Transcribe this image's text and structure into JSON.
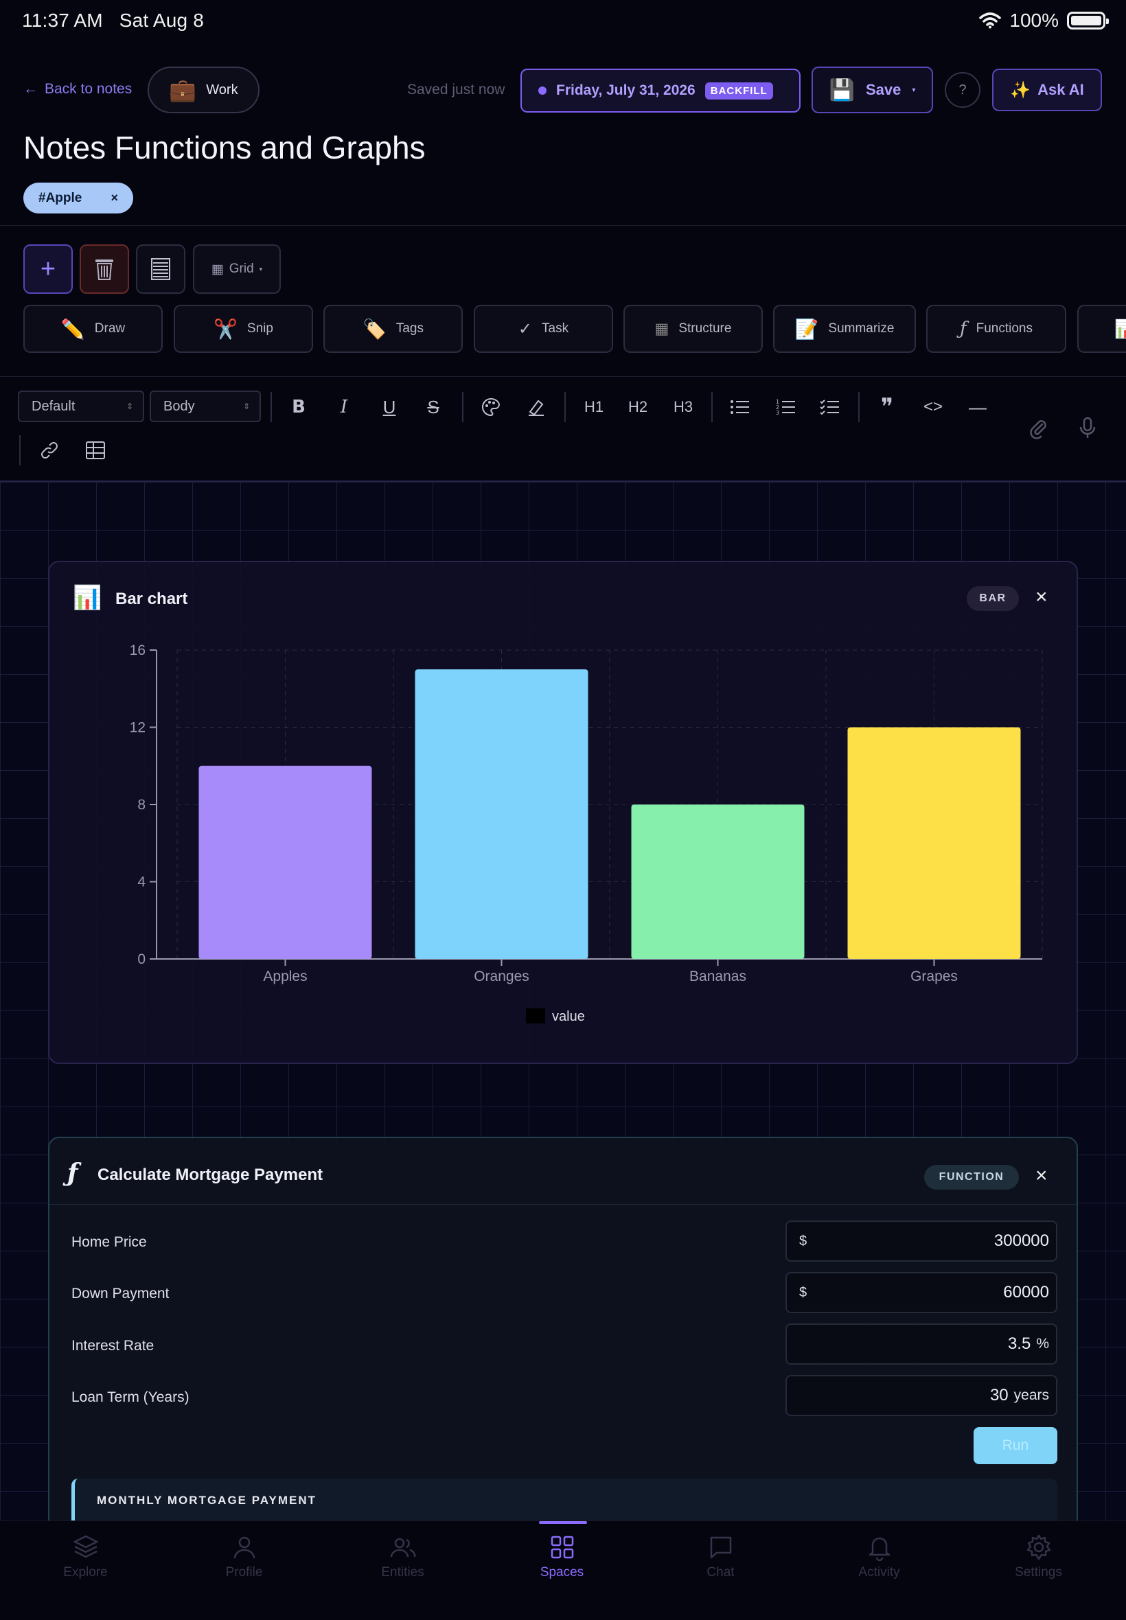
{
  "status_bar": {
    "time": "11:37 AM",
    "date": "Sat Aug 8",
    "battery": "100%"
  },
  "header": {
    "back_label": "Back to notes",
    "workspace_label": "Work",
    "saved_status": "Saved just now",
    "date_label": "Friday, July 31, 2026",
    "backfill_badge": "BACKFILL",
    "save_label": "Save",
    "help_label": "?",
    "ask_ai_label": "Ask AI"
  },
  "note": {
    "title": "Notes Functions and Graphs",
    "tag": "#Apple"
  },
  "toolbar": {
    "grid_label": "Grid",
    "actions": [
      {
        "label": "Draw",
        "icon": "pencil-icon"
      },
      {
        "label": "Snip",
        "icon": "scissors-icon"
      },
      {
        "label": "Tags",
        "icon": "tag-icon"
      },
      {
        "label": "Task",
        "icon": "check-icon"
      },
      {
        "label": "Structure",
        "icon": "structure-icon"
      },
      {
        "label": "Summarize",
        "icon": "memo-icon"
      },
      {
        "label": "Functions",
        "icon": "function-icon"
      }
    ]
  },
  "format_bar": {
    "font_select": "Default",
    "style_select": "Body",
    "headings": [
      "H1",
      "H2",
      "H3"
    ]
  },
  "chart_card": {
    "title": "Bar chart",
    "badge": "BAR",
    "close": "×"
  },
  "chart_data": {
    "type": "bar",
    "categories": [
      "Apples",
      "Oranges",
      "Bananas",
      "Grapes"
    ],
    "values": [
      10,
      15,
      8,
      12
    ],
    "colors": [
      "#a78bfa",
      "#7dd3fc",
      "#86efac",
      "#fde047"
    ],
    "series": [
      {
        "name": "value",
        "values": [
          10,
          15,
          8,
          12
        ]
      }
    ],
    "yticks": [
      0,
      4,
      8,
      12,
      16
    ],
    "ylim": [
      0,
      16
    ],
    "grid": true,
    "legend": "bottom-center"
  },
  "function_card": {
    "title": "Calculate Mortgage Payment",
    "badge": "FUNCTION",
    "close": "×",
    "fields": [
      {
        "label": "Home Price",
        "prefix": "$",
        "value": "300000",
        "suffix": ""
      },
      {
        "label": "Down Payment",
        "prefix": "$",
        "value": "60000",
        "suffix": ""
      },
      {
        "label": "Interest Rate",
        "prefix": "",
        "value": "3.5",
        "suffix": "%"
      },
      {
        "label": "Loan Term (Years)",
        "prefix": "",
        "value": "30",
        "suffix": "years"
      }
    ],
    "run_label": "Run",
    "result_label": "MONTHLY MORTGAGE PAYMENT"
  },
  "tabbar": {
    "tabs": [
      {
        "label": "Explore",
        "icon": "layers-icon"
      },
      {
        "label": "Profile",
        "icon": "person-icon"
      },
      {
        "label": "Entities",
        "icon": "people-icon"
      },
      {
        "label": "Spaces",
        "icon": "grid-icon",
        "active": true
      },
      {
        "label": "Chat",
        "icon": "chat-icon"
      },
      {
        "label": "Activity",
        "icon": "bell-icon"
      },
      {
        "label": "Settings",
        "icon": "gear-icon"
      }
    ]
  }
}
